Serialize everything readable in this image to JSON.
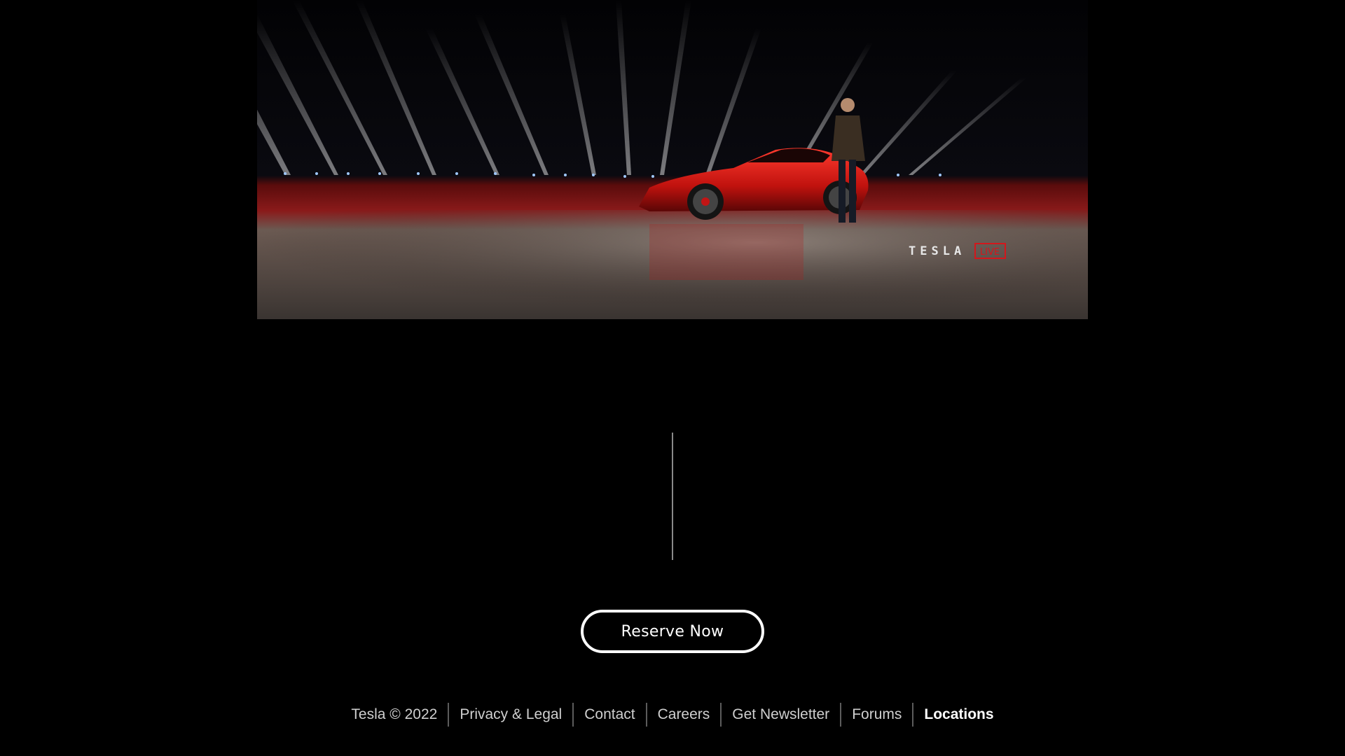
{
  "hero": {
    "logo_text": "TESLA",
    "live_badge": "LIVE"
  },
  "cta": {
    "reserve_label": "Reserve Now"
  },
  "footer": {
    "copyright": "Tesla © 2022",
    "links": [
      {
        "label": "Privacy & Legal"
      },
      {
        "label": "Contact"
      },
      {
        "label": "Careers"
      },
      {
        "label": "Get Newsletter"
      },
      {
        "label": "Forums"
      },
      {
        "label": "Locations",
        "active": true
      }
    ]
  },
  "colors": {
    "background": "#000000",
    "accent_red": "#d3171c",
    "text": "#cfcfcf",
    "text_active": "#ffffff"
  }
}
